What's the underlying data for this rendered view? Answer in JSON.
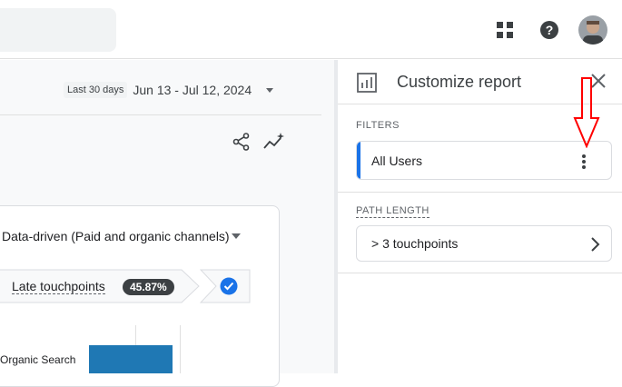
{
  "topbar": {
    "icons": [
      "apps-icon",
      "help-icon",
      "avatar"
    ]
  },
  "report": {
    "date_chip": "Last 30 days",
    "date_range": "Jun 13 - Jul 12, 2024",
    "model": "Data-driven (Paid and organic channels)",
    "touchpoint_label": "Late touchpoints",
    "touchpoint_value": "45.87%",
    "bar_category": "Organic Search"
  },
  "panel": {
    "title": "Customize report",
    "filters_label": "FILTERS",
    "filter_item": "All Users",
    "path_length_label": "PATH LENGTH",
    "path_length_value": "> 3 touchpoints"
  },
  "colors": {
    "accent": "#1a73e8",
    "bar": "#1f78b4",
    "annotation": "#ff0000"
  }
}
